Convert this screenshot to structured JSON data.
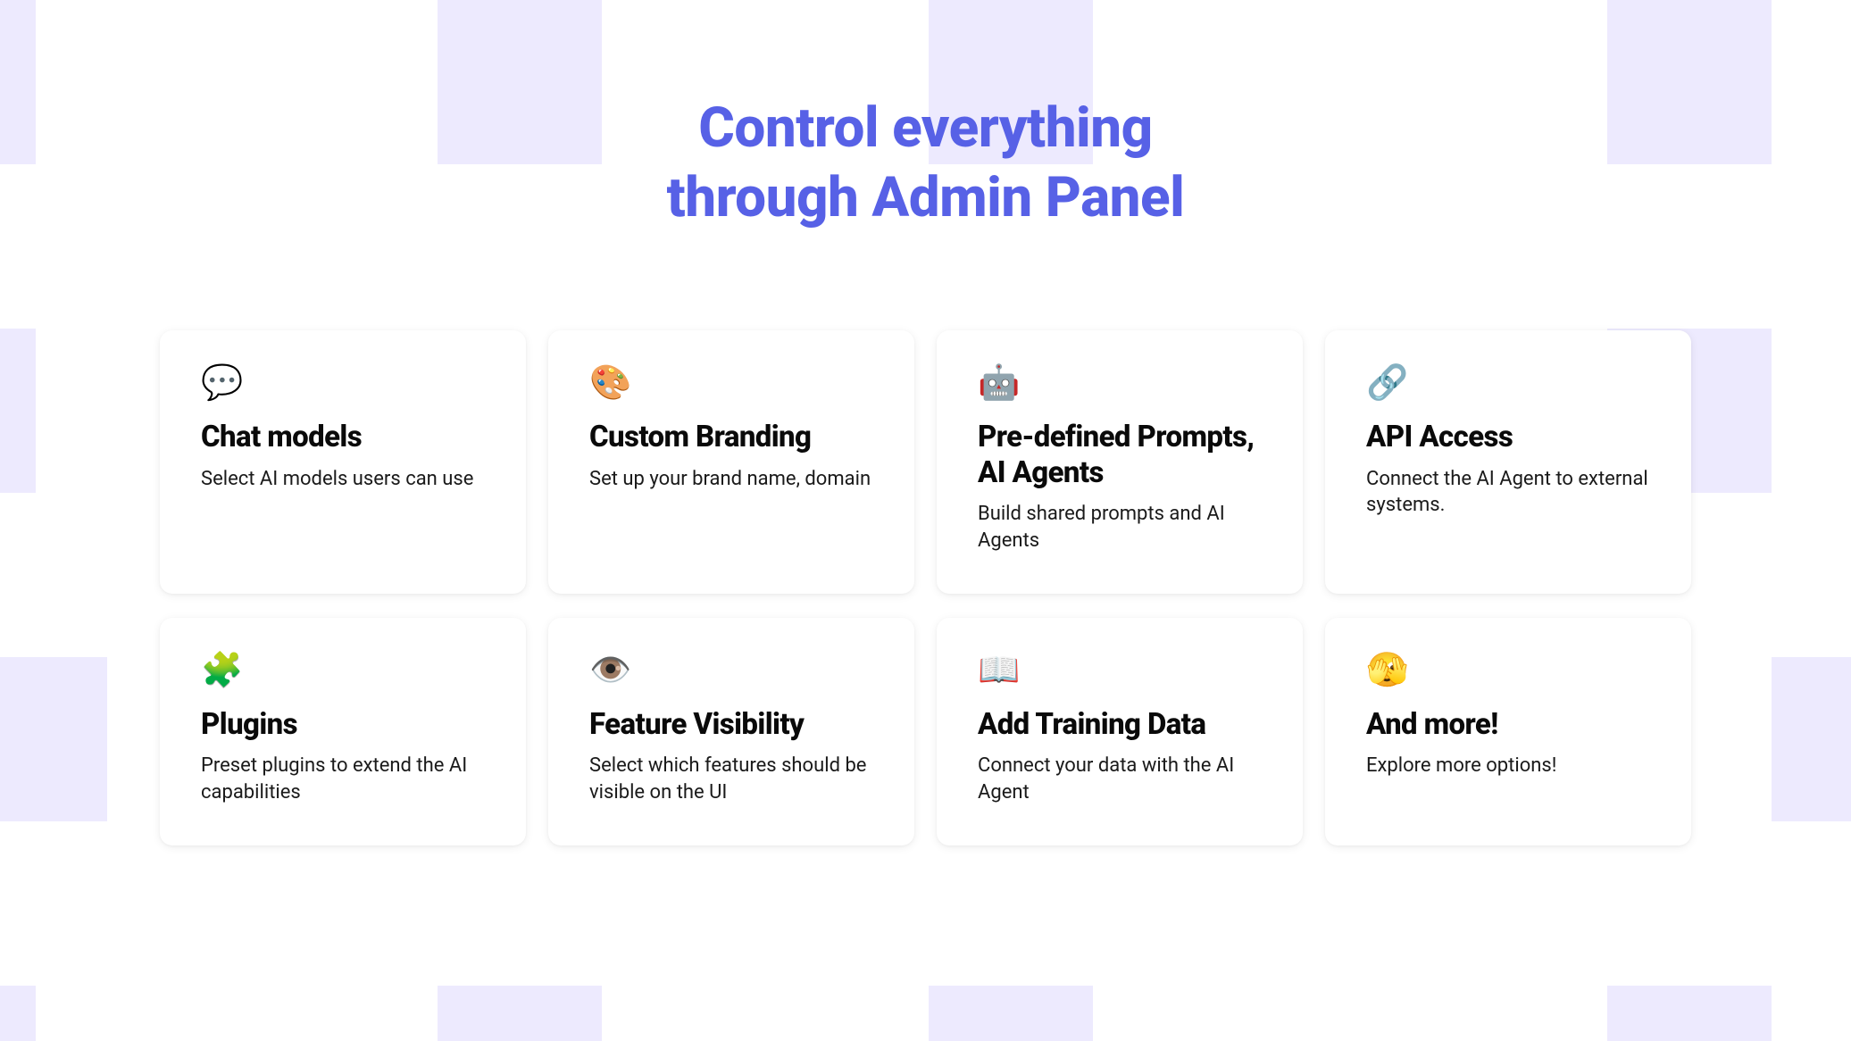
{
  "heading_line1": "Control everything",
  "heading_line2": "through Admin Panel",
  "cards": [
    {
      "icon": "💬",
      "title": "Chat models",
      "desc": "Select AI models users can use"
    },
    {
      "icon": "🎨",
      "title": "Custom Branding",
      "desc": "Set up your brand name, domain"
    },
    {
      "icon": "🤖",
      "title": "Pre-defined Prompts, AI Agents",
      "desc": "Build shared prompts and AI Agents"
    },
    {
      "icon": "🔗",
      "title": "API Access",
      "desc": "Connect the AI Agent to external systems."
    },
    {
      "icon": "🧩",
      "title": "Plugins",
      "desc": "Preset plugins to extend the AI capabilities"
    },
    {
      "icon": "👁️",
      "title": "Feature Visibility",
      "desc": "Select which features should be visible on the UI"
    },
    {
      "icon": "📖",
      "title": "Add Training Data",
      "desc": "Connect your data with the AI Agent"
    },
    {
      "icon": "🫣",
      "title": "And more!",
      "desc": "Explore more options!"
    }
  ]
}
